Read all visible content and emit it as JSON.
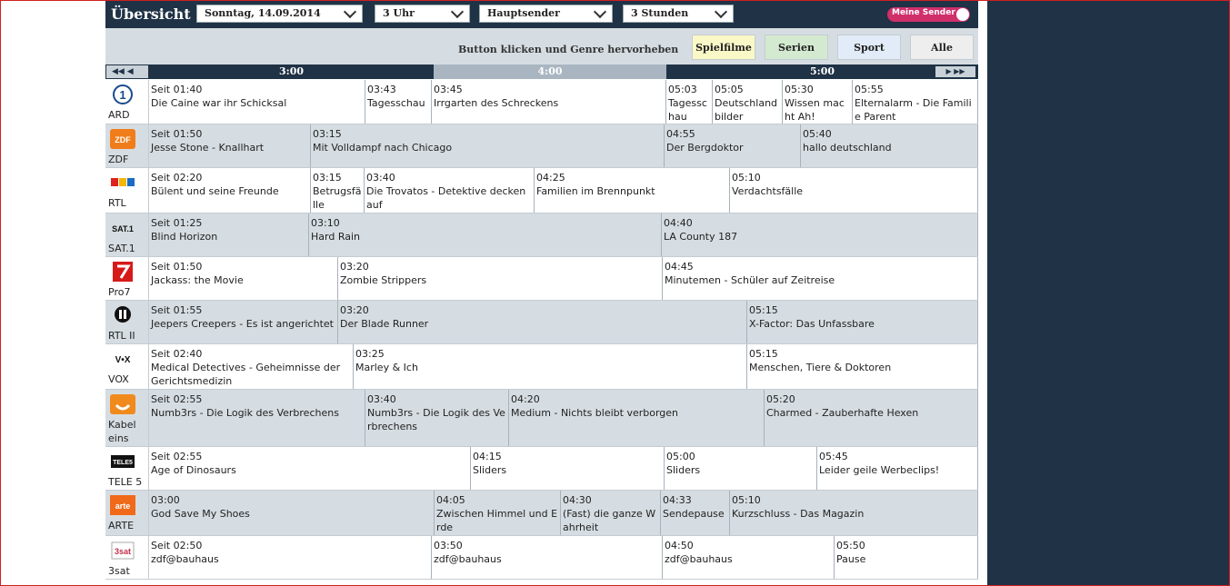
{
  "header": {
    "title": "Übersicht",
    "date_select": "Sonntag, 14.09.2014",
    "time_select": "3 Uhr",
    "channel_select": "Hauptsender",
    "duration_select": "3 Stunden",
    "meine_sender": "Meine Sender"
  },
  "genre": {
    "hint": "Button klicken und Genre hervorheben",
    "buttons": [
      {
        "label": "Spielfilme",
        "color": "#fbf8c8"
      },
      {
        "label": "Serien",
        "color": "#d4ead0"
      },
      {
        "label": "Sport",
        "color": "#e2ecf8"
      },
      {
        "label": "Alle",
        "color": "#eeeeee"
      }
    ]
  },
  "timeline": {
    "slots": [
      "3:00",
      "4:00",
      "5:00"
    ],
    "nav_left": "◀◀ ◀",
    "nav_right": "▶ ▶▶"
  },
  "channels": [
    {
      "name": "ARD",
      "icon": "ard-logo-icon",
      "programs": [
        {
          "time": "Seit 01:40",
          "title": "Die Caine war ihr Schicksal"
        },
        {
          "time": "03:43",
          "title": "Tagesschau"
        },
        {
          "time": "03:45",
          "title": "Irrgarten des Schreckens"
        },
        {
          "time": "05:03",
          "title": "Tagesschau"
        },
        {
          "time": "05:05",
          "title": "Deutschlandbilder"
        },
        {
          "time": "05:30",
          "title": "Wissen macht Ah!"
        },
        {
          "time": "05:55",
          "title": "Elternalarm - Die Familie Parent"
        }
      ]
    },
    {
      "name": "ZDF",
      "icon": "zdf-logo-icon",
      "programs": [
        {
          "time": "Seit 01:50",
          "title": "Jesse Stone - Knallhart"
        },
        {
          "time": "03:15",
          "title": "Mit Volldampf nach Chicago"
        },
        {
          "time": "04:55",
          "title": "Der Bergdoktor"
        },
        {
          "time": "05:40",
          "title": "hallo deutschland"
        }
      ]
    },
    {
      "name": "RTL",
      "icon": "rtl-logo-icon",
      "programs": [
        {
          "time": "Seit 02:20",
          "title": "Bülent und seine Freunde"
        },
        {
          "time": "03:15",
          "title": "Betrugsfälle"
        },
        {
          "time": "03:40",
          "title": "Die Trovatos - Detektive decken auf"
        },
        {
          "time": "04:25",
          "title": "Familien im Brennpunkt"
        },
        {
          "time": "05:10",
          "title": "Verdachtsfälle"
        }
      ]
    },
    {
      "name": "SAT.1",
      "icon": "sat1-logo-icon",
      "programs": [
        {
          "time": "Seit 01:25",
          "title": "Blind Horizon"
        },
        {
          "time": "03:10",
          "title": "Hard Rain"
        },
        {
          "time": "04:40",
          "title": "LA County 187"
        }
      ]
    },
    {
      "name": "Pro7",
      "icon": "pro7-logo-icon",
      "programs": [
        {
          "time": "Seit 01:50",
          "title": "Jackass: the Movie"
        },
        {
          "time": "03:20",
          "title": "Zombie Strippers"
        },
        {
          "time": "04:45",
          "title": "Minutemen - Schüler auf Zeitreise"
        }
      ]
    },
    {
      "name": "RTL II",
      "icon": "rtl2-logo-icon",
      "programs": [
        {
          "time": "Seit 01:55",
          "title": "Jeepers Creepers - Es ist angerichtet"
        },
        {
          "time": "03:20",
          "title": "Der Blade Runner"
        },
        {
          "time": "05:15",
          "title": "X-Factor: Das Unfassbare"
        }
      ]
    },
    {
      "name": "VOX",
      "icon": "vox-logo-icon",
      "programs": [
        {
          "time": "Seit 02:40",
          "title": "Medical Detectives - Geheimnisse der Gerichtsmedizin"
        },
        {
          "time": "03:25",
          "title": "Marley & Ich"
        },
        {
          "time": "05:15",
          "title": "Menschen, Tiere & Doktoren"
        }
      ]
    },
    {
      "name": "Kabel eins",
      "icon": "kabeleins-logo-icon",
      "programs": [
        {
          "time": "Seit 02:55",
          "title": "Numb3rs - Die Logik des Verbrechens"
        },
        {
          "time": "03:40",
          "title": "Numb3rs - Die Logik des Verbrechens"
        },
        {
          "time": "04:20",
          "title": "Medium - Nichts bleibt verborgen"
        },
        {
          "time": "05:20",
          "title": "Charmed - Zauberhafte Hexen"
        }
      ]
    },
    {
      "name": "TELE 5",
      "icon": "tele5-logo-icon",
      "programs": [
        {
          "time": "Seit 02:55",
          "title": "Age of Dinosaurs"
        },
        {
          "time": "04:15",
          "title": "Sliders"
        },
        {
          "time": "05:00",
          "title": "Sliders"
        },
        {
          "time": "05:45",
          "title": "Leider geile Werbeclips!"
        }
      ]
    },
    {
      "name": "ARTE",
      "icon": "arte-logo-icon",
      "programs": [
        {
          "time": "03:00",
          "title": "God Save My Shoes"
        },
        {
          "time": "04:05",
          "title": "Zwischen Himmel und Erde"
        },
        {
          "time": "04:30",
          "title": "(Fast) die ganze Wahrheit"
        },
        {
          "time": "04:33",
          "title": "Sendepause"
        },
        {
          "time": "05:10",
          "title": "Kurzschluss - Das Magazin"
        }
      ]
    },
    {
      "name": "3sat",
      "icon": "3sat-logo-icon",
      "programs": [
        {
          "time": "Seit 02:50",
          "title": "zdf@bauhaus"
        },
        {
          "time": "03:50",
          "title": "zdf@bauhaus"
        },
        {
          "time": "04:50",
          "title": "zdf@bauhaus"
        },
        {
          "time": "05:50",
          "title": "Pause"
        }
      ]
    }
  ]
}
